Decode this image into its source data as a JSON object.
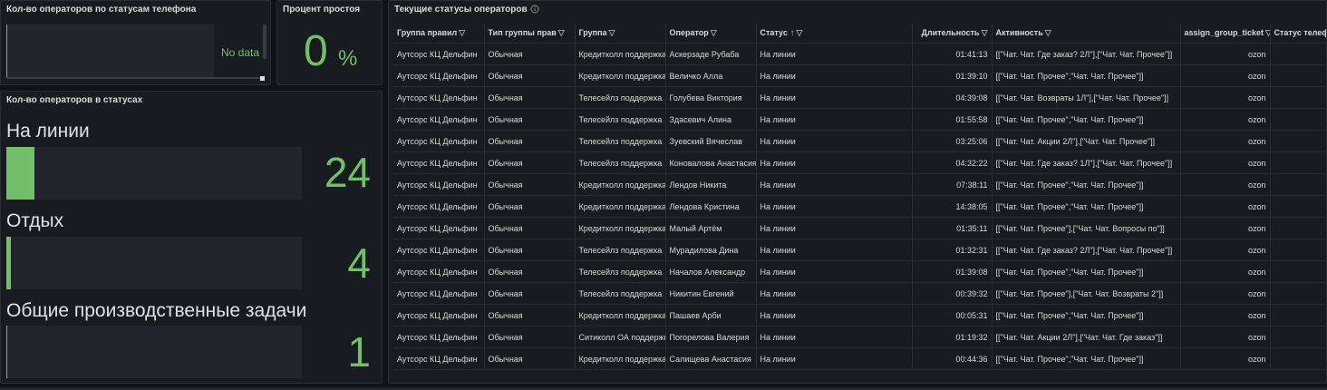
{
  "panel1": {
    "title": "Кол-во операторов по статусам телефона",
    "nodata": "No data"
  },
  "panel2": {
    "title": "Процент простоя",
    "value": "0",
    "unit": "%"
  },
  "panel3": {
    "title": "Кол-во операторов в статусах",
    "accent": "#73bf69",
    "bars": [
      {
        "label": "На линии",
        "value": "24",
        "level": 24
      },
      {
        "label": "Отдых",
        "value": "4",
        "level": 4
      },
      {
        "label": "Общие производственные задачи",
        "value": "1",
        "level": 1
      }
    ]
  },
  "table": {
    "title": "Текущие статусы операторов",
    "headers": [
      "Группа правил",
      "Тип группы прав",
      "Группа",
      "Оператор",
      "Статус",
      "Длительность",
      "Активность",
      "assign_group_ticket",
      "Статус телефона"
    ],
    "rows": [
      [
        "Аутсорс КЦ Дельфин",
        "Обычная",
        "Кредитколл поддержка",
        "Аскерзаде Рубаба",
        "На линии",
        "01:41:13",
        "[[\"Чат. Чат. Где заказ? 2Л\"],[\"Чат. Чат. Прочее\"]]",
        "ozon",
        ""
      ],
      [
        "Аутсорс КЦ Дельфин",
        "Обычная",
        "Кредитколл поддержка",
        "Величко Алла",
        "На линии",
        "01:39:10",
        "[[\"Чат. Чат. Прочее\",\"Чат. Чат. Прочее\"]]",
        "ozon",
        ""
      ],
      [
        "Аутсорс КЦ Дельфин",
        "Обычная",
        "Телесейлз поддержка",
        "Голубева Виктория",
        "На линии",
        "04:39:08",
        "[[\"Чат. Чат. Возвраты 1Л\"],[\"Чат. Чат. Прочее\"]]",
        "ozon",
        ""
      ],
      [
        "Аутсорс КЦ Дельфин",
        "Обычная",
        "Телесейлз поддержка",
        "Здасевич Алина",
        "На линии",
        "01:55:58",
        "[[\"Чат. Чат. Прочее\",\"Чат. Чат. Прочее\"]]",
        "ozon",
        ""
      ],
      [
        "Аутсорс КЦ Дельфин",
        "Обычная",
        "Телесейлз поддержка",
        "Зуевский Вячеслав",
        "На линии",
        "03:25:06",
        "[[\"Чат. Чат. Акции 2Л\"],[\"Чат. Чат. Прочее\"]]",
        "ozon",
        ""
      ],
      [
        "Аутсорс КЦ Дельфин",
        "Обычная",
        "Телесейлз поддержка",
        "Коновалова Анастасия",
        "На линии",
        "04:32:22",
        "[[\"Чат. Чат. Где заказ? 1Л\"],[\"Чат. Чат. Прочее\"]]",
        "ozon",
        ""
      ],
      [
        "Аутсорс КЦ Дельфин",
        "Обычная",
        "Кредитколл поддержка",
        "Лендов Никита",
        "На линии",
        "07:38:11",
        "[[\"Чат. Чат. Прочее\",\"Чат. Чат. Прочее\"]]",
        "ozon",
        ""
      ],
      [
        "Аутсорс КЦ Дельфин",
        "Обычная",
        "Кредитколл поддержка",
        "Лендова Кристина",
        "На линии",
        "14:38:05",
        "[[\"Чат. Чат. Прочее\",\"Чат. Чат. Прочее\"]]",
        "ozon",
        ""
      ],
      [
        "Аутсорс КЦ Дельфин",
        "Обычная",
        "Кредитколл поддержка",
        "Малый Артём",
        "На линии",
        "01:35:11",
        "[[\"Чат. Чат. Прочее\"],[\"Чат. Чат. Вопросы по\"]]",
        "ozon",
        ""
      ],
      [
        "Аутсорс КЦ Дельфин",
        "Обычная",
        "Телесейлз поддержка",
        "Мурадилова Дина",
        "На линии",
        "01:32:31",
        "[[\"Чат. Чат. Где заказ? 2Л\"],[\"Чат. Чат. Прочее\"]]",
        "ozon",
        ""
      ],
      [
        "Аутсорс КЦ Дельфин",
        "Обычная",
        "Телесейлз поддержка",
        "Началов Александр",
        "На линии",
        "01:39:08",
        "[[\"Чат. Чат. Прочее\",\"Чат. Чат. Прочее\"]]",
        "ozon",
        ""
      ],
      [
        "Аутсорс КЦ Дельфин",
        "Обычная",
        "Телесейлз поддержка",
        "Никитин Евгений",
        "На линии",
        "00:39:32",
        "[[\"Чат. Чат. Прочее\"],[\"Чат. Чат. Возвраты 2\"]]",
        "ozon",
        ""
      ],
      [
        "Аутсорс КЦ Дельфин",
        "Обычная",
        "Кредитколл поддержка",
        "Пашаев Арби",
        "На линии",
        "00:05:31",
        "[[\"Чат. Чат. Прочее\",\"Чат. Чат. Прочее\"]]",
        "ozon",
        ""
      ],
      [
        "Аутсорс КЦ Дельфин",
        "Обычная",
        "Ситиколл ОА поддержка",
        "Погорелова Валерия",
        "На линии",
        "01:19:32",
        "[[\"Чат. Чат. Акции 2Л\"],[\"Чат. Чат. Где заказ\"]]",
        "ozon",
        ""
      ],
      [
        "Аутсорс КЦ Дельфин",
        "Обычная",
        "Кредитколл поддержка",
        "Салищева Анастасия",
        "На линии",
        "00:44:36",
        "[[\"Чат. Чат. Прочее\",\"Чат. Чат. Прочее\"]]",
        "ozon",
        ""
      ]
    ]
  },
  "icons": {
    "filter": "filter-icon",
    "sort": "sort-asc-icon",
    "info": "info-icon"
  }
}
